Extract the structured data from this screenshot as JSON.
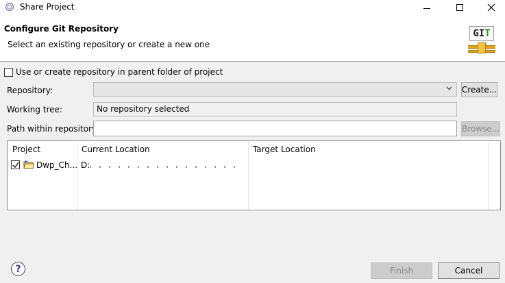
{
  "window": {
    "title": "Share Project"
  },
  "header": {
    "heading": "Configure Git Repository",
    "subtitle": "Select an existing repository or create a new one",
    "logo_text_g": "G",
    "logo_text_i": "I",
    "logo_text_t": "T"
  },
  "options": {
    "use_parent_label": "Use or create repository in parent folder of project",
    "use_parent_checked": false
  },
  "form": {
    "repository_label": "Repository:",
    "repository_value": "",
    "create_button": "Create...",
    "working_tree_label": "Working tree:",
    "working_tree_value": "No repository selected",
    "path_label": "Path within repository:",
    "path_value": "",
    "browse_button": "Browse..."
  },
  "table": {
    "columns": [
      "Project",
      "Current Location",
      "Target Location"
    ],
    "rows": [
      {
        "checked": true,
        "project": "Dwp_Ch...",
        "current_location": "D:",
        "target_location": ""
      }
    ]
  },
  "footer": {
    "help_icon": "?",
    "finish_button": "Finish",
    "cancel_button": "Cancel"
  },
  "icons": {
    "app": "eclipse-icon",
    "minimize": "minimize-icon",
    "maximize": "maximize-icon",
    "close": "close-icon",
    "logo": "git-logo",
    "dropdown": "chevron-down-icon",
    "folder": "project-folder-icon",
    "help": "help-icon"
  }
}
